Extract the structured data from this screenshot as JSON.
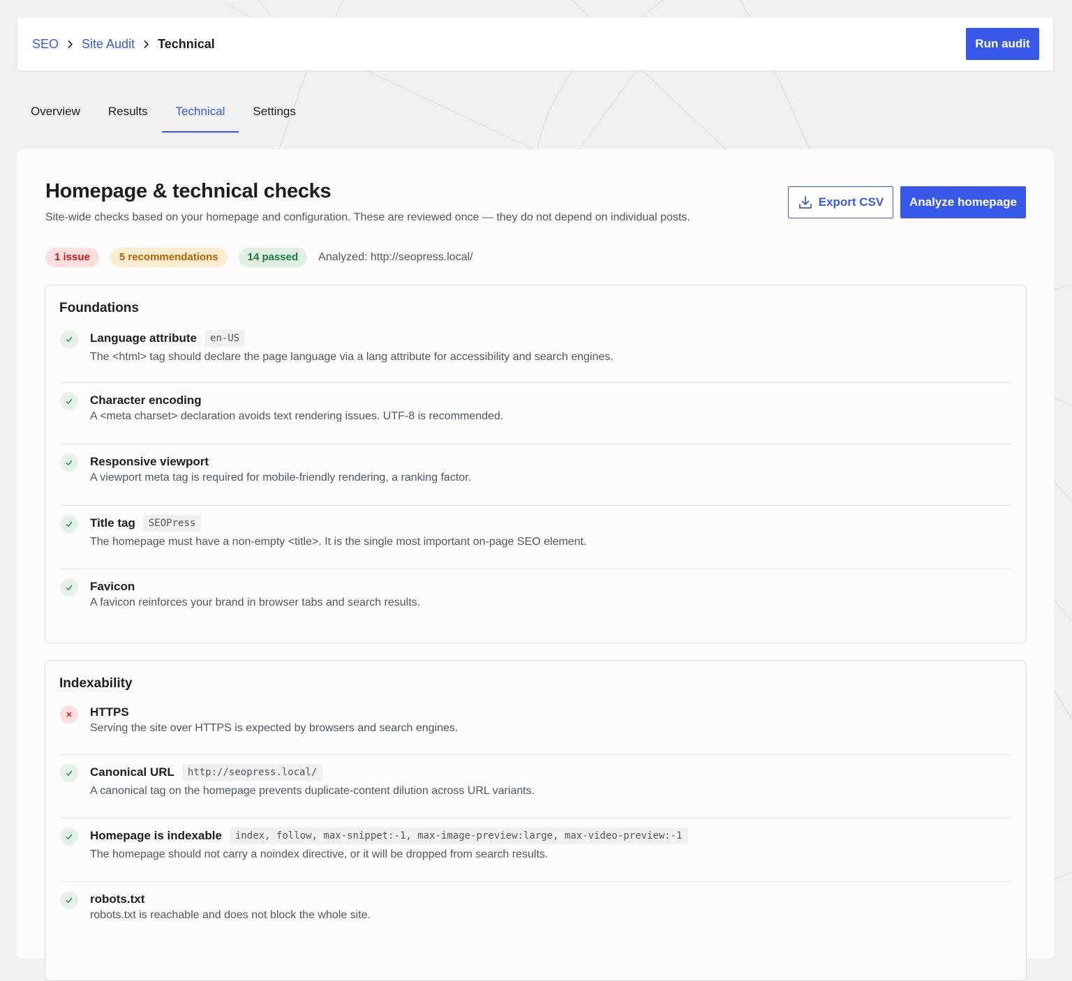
{
  "breadcrumb": {
    "seo": "SEO",
    "site_audit": "Site Audit",
    "current": "Technical"
  },
  "actions": {
    "run_audit": "Run audit",
    "export_csv": "Export CSV",
    "analyze_homepage": "Analyze homepage"
  },
  "tabs": [
    {
      "label": "Overview",
      "active": false
    },
    {
      "label": "Results",
      "active": false
    },
    {
      "label": "Technical",
      "active": true
    },
    {
      "label": "Settings",
      "active": false
    }
  ],
  "main": {
    "title": "Homepage & technical checks",
    "subtitle": "Site-wide checks based on your homepage and configuration. These are reviewed once — they do not depend on individual posts.",
    "badges": {
      "issues": "1 issue",
      "recommendations": "5 recommendations",
      "passed": "14 passed"
    },
    "analyzed": "Analyzed: http://seopress.local/"
  },
  "sections": [
    {
      "title": "Foundations",
      "checks": [
        {
          "name": "Language attribute",
          "status": "pass",
          "value": "en-US",
          "description": "The <html> tag should declare the page language via a lang attribute for accessibility and search engines."
        },
        {
          "name": "Character encoding",
          "status": "pass",
          "description": "A <meta charset> declaration avoids text rendering issues. UTF-8 is recommended."
        },
        {
          "name": "Responsive viewport",
          "status": "pass",
          "description": "A viewport meta tag is required for mobile-friendly rendering, a ranking factor."
        },
        {
          "name": "Title tag",
          "status": "pass",
          "value": "SEOPress",
          "description": "The homepage must have a non-empty <title>. It is the single most important on-page SEO element."
        },
        {
          "name": "Favicon",
          "status": "pass",
          "description": "A favicon reinforces your brand in browser tabs and search results."
        }
      ]
    },
    {
      "title": "Indexability",
      "checks": [
        {
          "name": "HTTPS",
          "status": "fail",
          "description": "Serving the site over HTTPS is expected by browsers and search engines."
        },
        {
          "name": "Canonical URL",
          "status": "pass",
          "value": "http://seopress.local/",
          "description": "A canonical tag on the homepage prevents duplicate-content dilution across URL variants."
        },
        {
          "name": "Homepage is indexable",
          "status": "pass",
          "value": "index, follow, max-snippet:-1, max-image-preview:large, max-video-preview:-1",
          "description": "The homepage should not carry a noindex directive, or it will be dropped from search results."
        },
        {
          "name": "robots.txt",
          "status": "pass",
          "description": "robots.txt is reachable and does not block the whole site."
        }
      ]
    }
  ],
  "colors": {
    "accent": "#3858e9",
    "pass": "#2d8a46",
    "fail": "#cc1818",
    "warning": "#b26200",
    "background": "#f0f0f1"
  },
  "icons": {
    "pass": "checkmark-icon",
    "fail": "cross-icon",
    "breadcrumb_separator": "chevron-right-icon",
    "export": "download-icon"
  }
}
